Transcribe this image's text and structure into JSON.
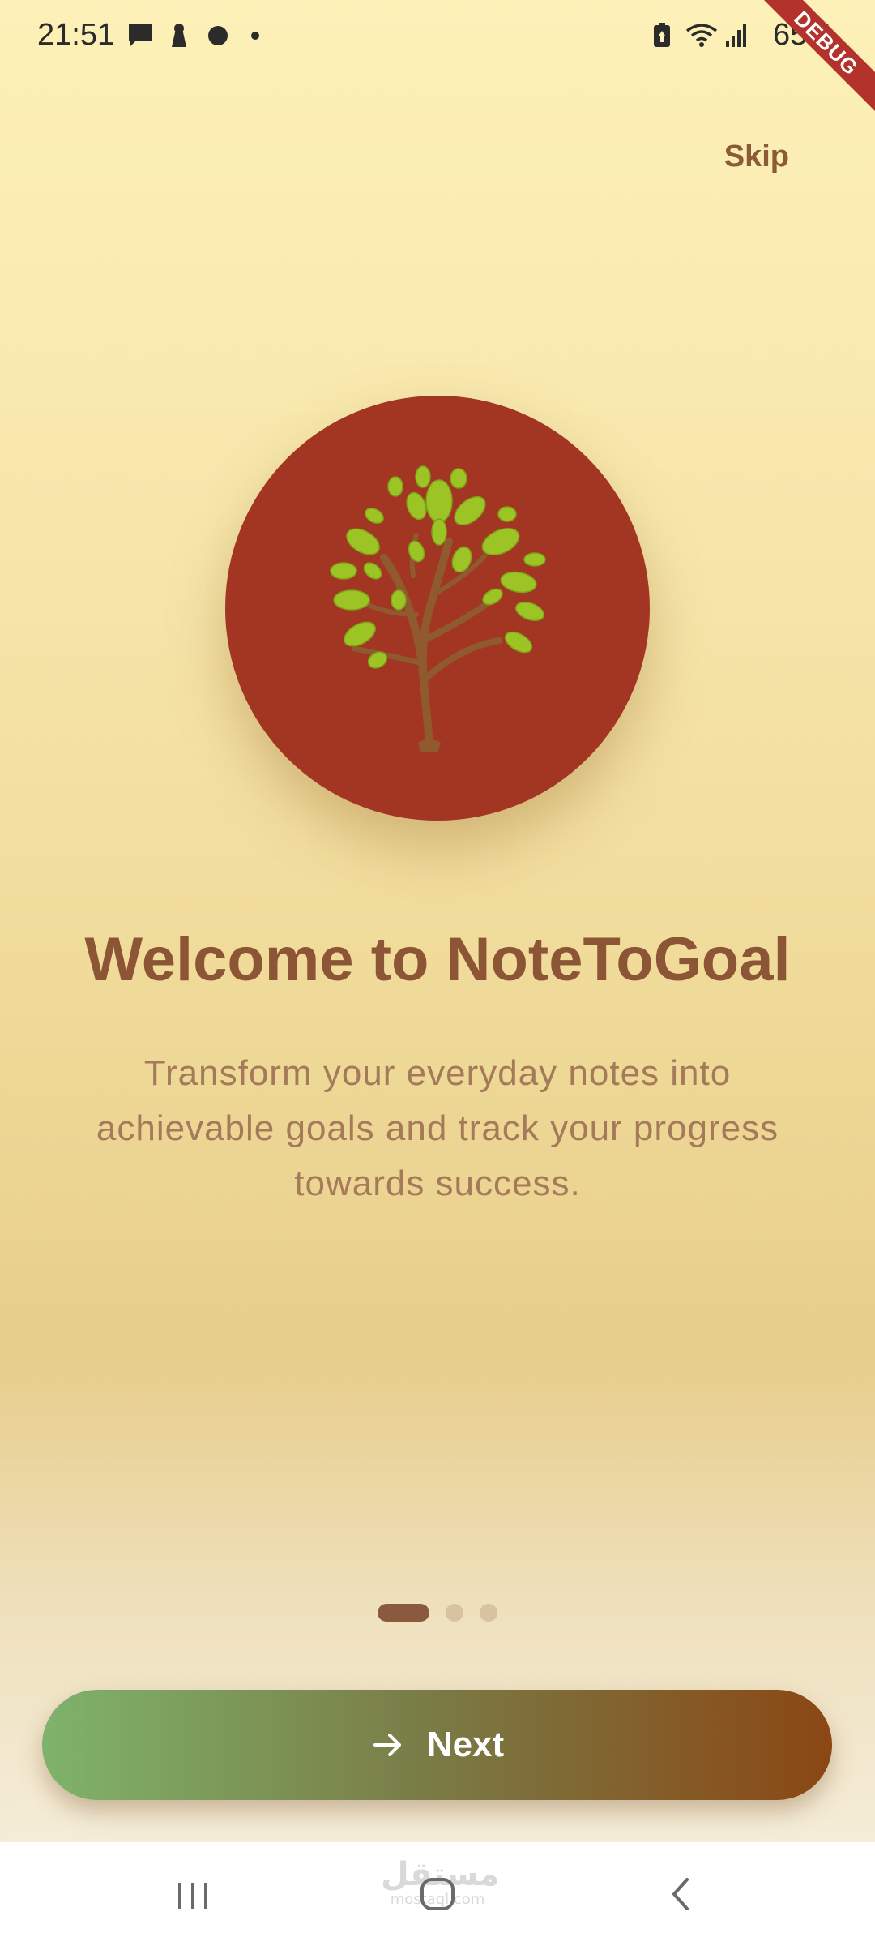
{
  "status_bar": {
    "time": "21:51",
    "battery": "65%",
    "left_icons": [
      "message-icon",
      "keyhole-icon",
      "circle-icon",
      "dot-icon"
    ],
    "right_icons": [
      "battery-saver-icon",
      "wifi-icon",
      "signal-icon",
      "battery-icon"
    ]
  },
  "debug_banner": {
    "label": "DEBUG"
  },
  "header": {
    "skip_label": "Skip"
  },
  "onboarding": {
    "logo_icon": "tree-icon",
    "title": "Welcome to NoteToGoal",
    "description": "Transform your everyday notes into achievable goals and track your progress towards success.",
    "current_page": 1,
    "total_pages": 3
  },
  "next_button": {
    "label": "Next",
    "icon": "arrow-right-icon"
  },
  "nav_bar": {
    "items": [
      "recents-icon",
      "home-icon",
      "back-icon"
    ]
  },
  "watermark": {
    "arabic": "مستقل",
    "latin": "mostaql.com"
  },
  "colors": {
    "accent_brown": "#8C5636",
    "logo_red": "#A33623",
    "leaf_green": "#9DC425",
    "button_start": "#7FB36C",
    "button_end": "#8B4714"
  }
}
